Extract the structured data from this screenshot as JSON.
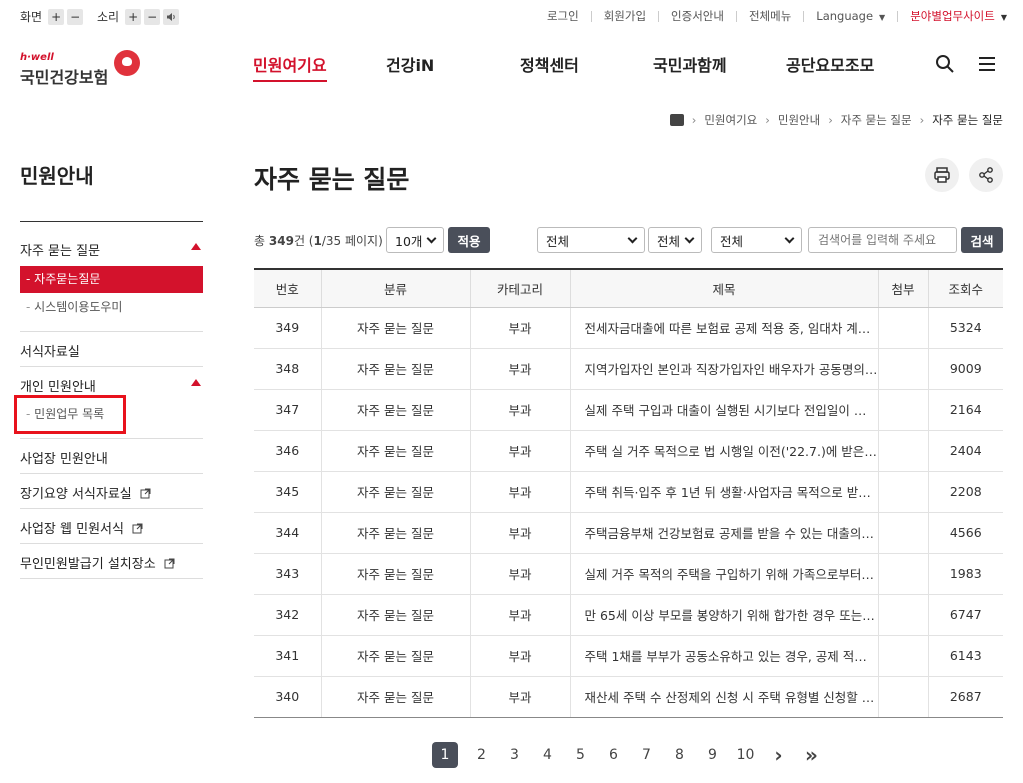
{
  "util": {
    "screen_label": "화면",
    "sound_label": "소리",
    "plus": "+",
    "minus": "−",
    "links": [
      "로그인",
      "회원가입",
      "인증서안내",
      "전체메뉴"
    ],
    "language": "Language",
    "partner": "분야별업무사이트"
  },
  "logo": {
    "tag": "h·well",
    "name": "국민건강보험"
  },
  "gnb": [
    "민원여기요",
    "건강iN",
    "정책센터",
    "국민과함께",
    "공단요모조모"
  ],
  "breadcrumb": [
    "민원여기요",
    "민원안내",
    "자주 묻는 질문",
    "자주 묻는 질문"
  ],
  "sidebar": {
    "title": "민원안내",
    "items": [
      {
        "label": "자주 묻는 질문"
      },
      {
        "label": "자주묻는질문"
      },
      {
        "label": "시스템이용도우미"
      },
      {
        "label": "서식자료실"
      },
      {
        "label": "개인 민원안내"
      },
      {
        "label": "민원업무 목록"
      },
      {
        "label": "사업장 민원안내"
      },
      {
        "label": "장기요양 서식자료실"
      },
      {
        "label": "사업장 웹 민원서식"
      },
      {
        "label": "무인민원발급기 설치장소"
      }
    ]
  },
  "page_title": "자주 묻는 질문",
  "toolbar": {
    "total_prefix": "총",
    "total_count": "349",
    "total_suffix": "건 (",
    "page_current": "1",
    "page_total": "/35 페이지)",
    "per_page": "10개",
    "apply": "적용",
    "filter1": "전체",
    "filter2": "전체",
    "filter3": "전체",
    "search_placeholder": "검색어를 입력해 주세요",
    "search_button": "검색"
  },
  "table": {
    "headers": [
      "번호",
      "분류",
      "카테고리",
      "제목",
      "첨부",
      "조회수"
    ],
    "rows": [
      [
        "349",
        "자주 묻는 질문",
        "부과",
        "전세자금대출에 따른 보험료 공제 적용 중, 임대차 계약 …",
        "",
        "5324"
      ],
      [
        "348",
        "자주 묻는 질문",
        "부과",
        "지역가입자인 본인과 직장가입자인 배우자가 공동명의로…",
        "",
        "9009"
      ],
      [
        "347",
        "자주 묻는 질문",
        "부과",
        "실제 주택 구입과 대출이 실행된 시기보다 전입일이 늦어…",
        "",
        "2164"
      ],
      [
        "346",
        "자주 묻는 질문",
        "부과",
        "주택 실 거주 목적으로 법 시행일 이전('22.7.)에 받은 부…",
        "",
        "2404"
      ],
      [
        "345",
        "자주 묻는 질문",
        "부과",
        "주택 취득·입주 후 1년 뒤 생활·사업자금 목적으로 받은…",
        "",
        "2208"
      ],
      [
        "344",
        "자주 묻는 질문",
        "부과",
        "주택금융부채 건강보험료 공제를 받을 수 있는 대출의 종…",
        "",
        "4566"
      ],
      [
        "343",
        "자주 묻는 질문",
        "부과",
        "실제 거주 목적의 주택을 구입하기 위해 가족으로부터 돈…",
        "",
        "1983"
      ],
      [
        "342",
        "자주 묻는 질문",
        "부과",
        "만 65세 이상 부모를 봉양하기 위해 합가한 경우 또는 미…",
        "",
        "6747"
      ],
      [
        "341",
        "자주 묻는 질문",
        "부과",
        "주택 1채를 부부가 공동소유하고 있는 경우, 공제 적용 대…",
        "",
        "6143"
      ],
      [
        "340",
        "자주 묻는 질문",
        "부과",
        "재산세 주택 수 산정제외 신청 시 주택 유형별 신청할 수 …",
        "",
        "2687"
      ]
    ]
  },
  "pager": [
    "1",
    "2",
    "3",
    "4",
    "5",
    "6",
    "7",
    "8",
    "9",
    "10",
    "›",
    "»"
  ],
  "colors": {
    "accent": "#d3122c",
    "dark_button": "#4a4f5a"
  }
}
